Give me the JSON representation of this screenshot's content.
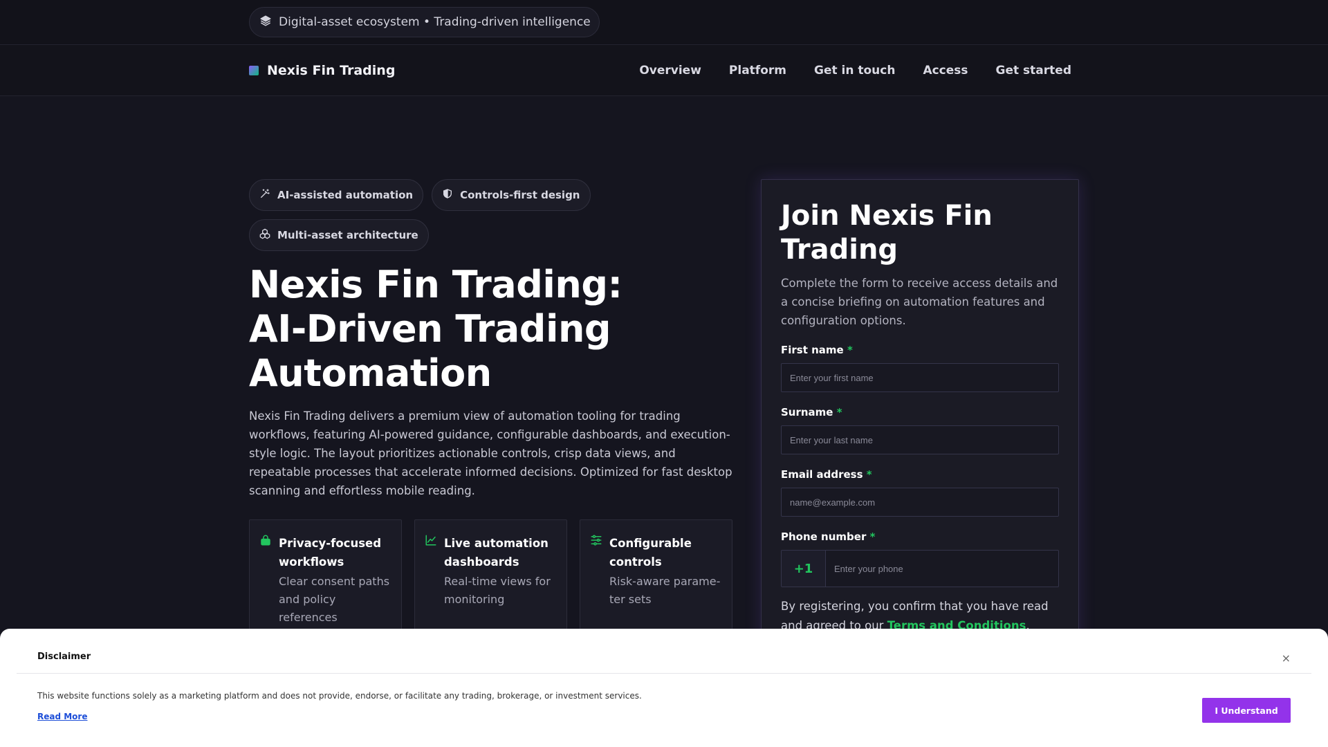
{
  "announcement": {
    "text": "Digital-asset ecosystem • Trading-driven intelligence",
    "icon": "layers-icon"
  },
  "brand": {
    "name": "Nexis Fin Trading"
  },
  "nav": {
    "items": [
      "Overview",
      "Platform",
      "Get in touch",
      "Access",
      "Get started"
    ]
  },
  "tags": [
    {
      "label": "AI-assisted automation",
      "icon": "magic-wand-icon"
    },
    {
      "label": "Controls-first design",
      "icon": "shield-icon"
    },
    {
      "label": "Multi-asset architecture",
      "icon": "cubes-icon"
    }
  ],
  "hero": {
    "title_line1": "Nexis Fin Trading:",
    "title_line2": "AI-Driven Trading",
    "title_line3": "Automation",
    "description": "Nexis Fin Trading delivers a premium view of automation tooling for trading workflows, featuring AI-powered guidance, configurable dashboards, and execution-style logic. The layout prioritizes actionable controls, crisp data views, and repeatable processes that accelerate informed decisions. Optimized for fast desktop scanning and effortless mobile reading."
  },
  "features": [
    {
      "title": "Privacy-focused workflows",
      "desc": "Clear consent paths and policy references",
      "icon": "lock-icon"
    },
    {
      "title": "Live automation dashboards",
      "desc": "Real-time views for monitoring",
      "icon": "line-chart-icon"
    },
    {
      "title": "Configurable controls",
      "desc": "Risk-aware parame-ter sets",
      "icon": "sliders-icon"
    }
  ],
  "form": {
    "title": "Join Nexis Fin Trading",
    "subtitle": "Complete the form to receive access details and a concise briefing on automation features and configuration options.",
    "first_name": {
      "label": "First name",
      "required": "*",
      "placeholder": "Enter your first name",
      "value": ""
    },
    "surname": {
      "label": "Surname",
      "required": "*",
      "placeholder": "Enter your last name",
      "value": ""
    },
    "email": {
      "label": "Email address",
      "required": "*",
      "placeholder": "name@example.com",
      "value": ""
    },
    "phone": {
      "label": "Phone number",
      "required": "*",
      "code": "+1",
      "placeholder": "Enter your phone",
      "value": ""
    },
    "consent_text": "By registering, you confirm that you have read and agreed to our",
    "consent_link": "Terms and Conditions",
    "consent_tail": ","
  },
  "disclaimer": {
    "title": "Disclaimer",
    "close": "×",
    "text": "This website functions solely as a marketing platform and does not provide, endorse, or facilitate any trading, brokerage, or investment services.",
    "read_more": "Read More",
    "button": "I Understand"
  },
  "colors": {
    "accent_green": "#22c55e",
    "accent_purple": "#9333ea",
    "background": "#15151f"
  }
}
